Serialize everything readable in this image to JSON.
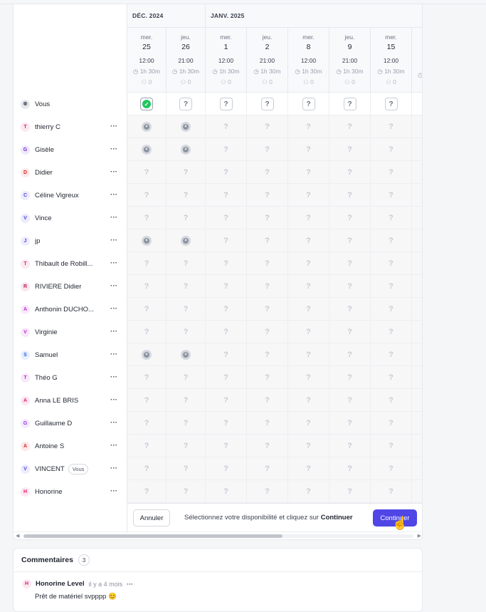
{
  "months": [
    {
      "label": "DÉC. 2024"
    },
    {
      "label": "JANV. 2025"
    }
  ],
  "dates": [
    {
      "dow": "mer.",
      "day": "25",
      "time": "12:00",
      "duration": "1h 30m",
      "count": "0"
    },
    {
      "dow": "jeu.",
      "day": "26",
      "time": "21:00",
      "duration": "1h 30m",
      "count": "0"
    },
    {
      "dow": "mer.",
      "day": "1",
      "time": "12:00",
      "duration": "1h 30m",
      "count": "0"
    },
    {
      "dow": "jeu.",
      "day": "2",
      "time": "21:00",
      "duration": "1h 30m",
      "count": "0"
    },
    {
      "dow": "mer.",
      "day": "8",
      "time": "12:00",
      "duration": "1h 30m",
      "count": "0"
    },
    {
      "dow": "jeu.",
      "day": "9",
      "time": "21:00",
      "duration": "1h 30m",
      "count": "0"
    },
    {
      "dow": "mer.",
      "day": "15",
      "time": "12:00",
      "duration": "1h 30m",
      "count": "0"
    }
  ],
  "you": {
    "name": "Vous",
    "avatar": "person-icon"
  },
  "participants": [
    {
      "name": "thierry C",
      "initial": "T",
      "color": "#e11d74",
      "no": [
        0,
        1
      ]
    },
    {
      "name": "Gisèle",
      "initial": "G",
      "color": "#6d28d9",
      "no": [
        0,
        1
      ]
    },
    {
      "name": "Didier",
      "initial": "D",
      "color": "#dc2626",
      "no": []
    },
    {
      "name": "Céline Vigreux",
      "initial": "C",
      "color": "#4f46e5",
      "no": []
    },
    {
      "name": "Vince",
      "initial": "V",
      "color": "#4f46e5",
      "no": []
    },
    {
      "name": "jp",
      "initial": "J",
      "color": "#4f46e5",
      "no": [
        0,
        1
      ]
    },
    {
      "name": "Thibault de Robill...",
      "initial": "T",
      "color": "#e11d74",
      "no": []
    },
    {
      "name": "RIVIERE Didier",
      "initial": "R",
      "color": "#be185d",
      "no": []
    },
    {
      "name": "Anthonin DUCHO...",
      "initial": "A",
      "color": "#c026d3",
      "no": []
    },
    {
      "name": "Virginie",
      "initial": "V",
      "color": "#c026d3",
      "no": []
    },
    {
      "name": "Samuel",
      "initial": "S",
      "color": "#2563eb",
      "no": [
        0,
        1
      ]
    },
    {
      "name": "Théo G",
      "initial": "T",
      "color": "#c026d3",
      "no": []
    },
    {
      "name": "Anna LE BRIS",
      "initial": "A",
      "color": "#e11d74",
      "no": []
    },
    {
      "name": "Guillaume D",
      "initial": "G",
      "color": "#9333ea",
      "no": []
    },
    {
      "name": "Antoine S",
      "initial": "A",
      "color": "#dc2626",
      "no": []
    },
    {
      "name": "VINCENT",
      "initial": "V",
      "color": "#4f46e5",
      "no": [],
      "badge": "Vous"
    },
    {
      "name": "Honorine",
      "initial": "H",
      "color": "#e11d74",
      "no": []
    }
  ],
  "footer": {
    "cancel": "Annuler",
    "hint_prefix": "Sélectionnez votre disponibilité et cliquez sur ",
    "hint_bold": "Continuer",
    "continue": "Continuer"
  },
  "comments": {
    "title": "Commentaires",
    "count": "3",
    "items": [
      {
        "initial": "H",
        "author": "Honorine Level",
        "time": "il y a 4 mois",
        "text": "Prêt de matériel svpppp 😊"
      }
    ]
  },
  "colors": {
    "accent": "#4f46e5",
    "yes": "#22c55e"
  }
}
